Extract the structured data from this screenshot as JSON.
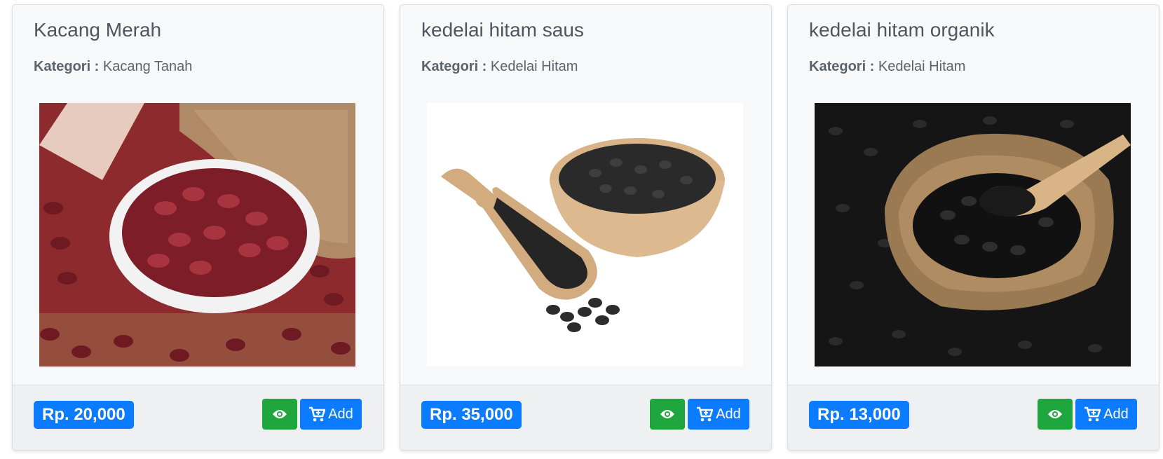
{
  "category_label": "Kategori :",
  "add_label": "Add",
  "icons": {
    "view": "eye-icon",
    "add": "cart-plus-icon"
  },
  "colors": {
    "price_badge": "#0b7bff",
    "view_button": "#1fa63e",
    "add_button": "#0b7bff"
  },
  "products": [
    {
      "name": "Kacang Merah",
      "category": "Kacang Tanah",
      "price": "Rp. 20,000",
      "image": "red-kidney-beans-photo"
    },
    {
      "name": "kedelai hitam saus",
      "category": "Kedelai Hitam",
      "price": "Rp. 35,000",
      "image": "black-beans-bowl-scoop-photo"
    },
    {
      "name": "kedelai hitam organik",
      "category": "Kedelai Hitam",
      "price": "Rp. 13,000",
      "image": "black-beans-sack-spoon-photo"
    }
  ]
}
